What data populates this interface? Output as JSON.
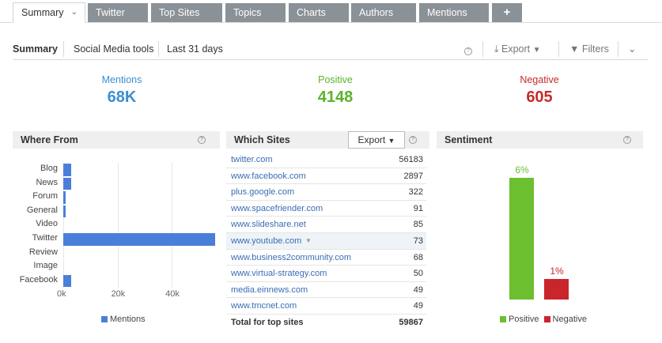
{
  "tabs": [
    {
      "label": "Summary",
      "active": true
    },
    {
      "label": "Twitter"
    },
    {
      "label": "Top Sites"
    },
    {
      "label": "Topics"
    },
    {
      "label": "Charts"
    },
    {
      "label": "Authors"
    },
    {
      "label": "Mentions"
    },
    {
      "label": "+"
    }
  ],
  "toolbar": {
    "summary": "Summary",
    "source": "Social Media tools",
    "range": "Last 31 days",
    "export": "Export",
    "filters": "Filters"
  },
  "kpis": {
    "mentions": {
      "label": "Mentions",
      "value": "68K",
      "color": "#3b8fd0"
    },
    "positive": {
      "label": "Positive",
      "value": "4148",
      "color": "#5cb22b"
    },
    "negative": {
      "label": "Negative",
      "value": "605",
      "color": "#c62b2b"
    }
  },
  "where_from": {
    "title": "Where From",
    "legend": "Mentions",
    "color": "#4a7fd9",
    "chart_data": {
      "type": "bar",
      "orientation": "horizontal",
      "categories": [
        "Blog",
        "News",
        "Forum",
        "General",
        "Video",
        "Twitter",
        "Review",
        "Image",
        "Facebook"
      ],
      "series": [
        {
          "name": "Mentions",
          "values": [
            3000,
            3000,
            1000,
            1000,
            0,
            56000,
            0,
            0,
            3000
          ]
        }
      ],
      "xticks": [
        "0k",
        "20k",
        "40k"
      ],
      "xlim": [
        0,
        56000
      ]
    }
  },
  "which_sites": {
    "title": "Which Sites",
    "export": "Export",
    "rows": [
      {
        "site": "twitter.com",
        "count": "56183"
      },
      {
        "site": "www.facebook.com",
        "count": "2897"
      },
      {
        "site": "plus.google.com",
        "count": "322"
      },
      {
        "site": "www.spacefriender.com",
        "count": "91"
      },
      {
        "site": "www.slideshare.net",
        "count": "85"
      },
      {
        "site": "www.youtube.com",
        "count": "73"
      },
      {
        "site": "www.business2community.com",
        "count": "68"
      },
      {
        "site": "www.virtual-strategy.com",
        "count": "50"
      },
      {
        "site": "media.einnews.com",
        "count": "49"
      },
      {
        "site": "www.tmcnet.com",
        "count": "49"
      }
    ],
    "total_label": "Total for top sites",
    "total_value": "59867"
  },
  "sentiment": {
    "title": "Sentiment",
    "chart_data": {
      "type": "bar",
      "categories": [
        "Positive",
        "Negative"
      ],
      "values": [
        6,
        1
      ],
      "labels": [
        "6%",
        "1%"
      ],
      "colors": [
        "#6cbf2e",
        "#c9252b"
      ]
    },
    "legend": [
      "Positive",
      "Negative"
    ]
  }
}
